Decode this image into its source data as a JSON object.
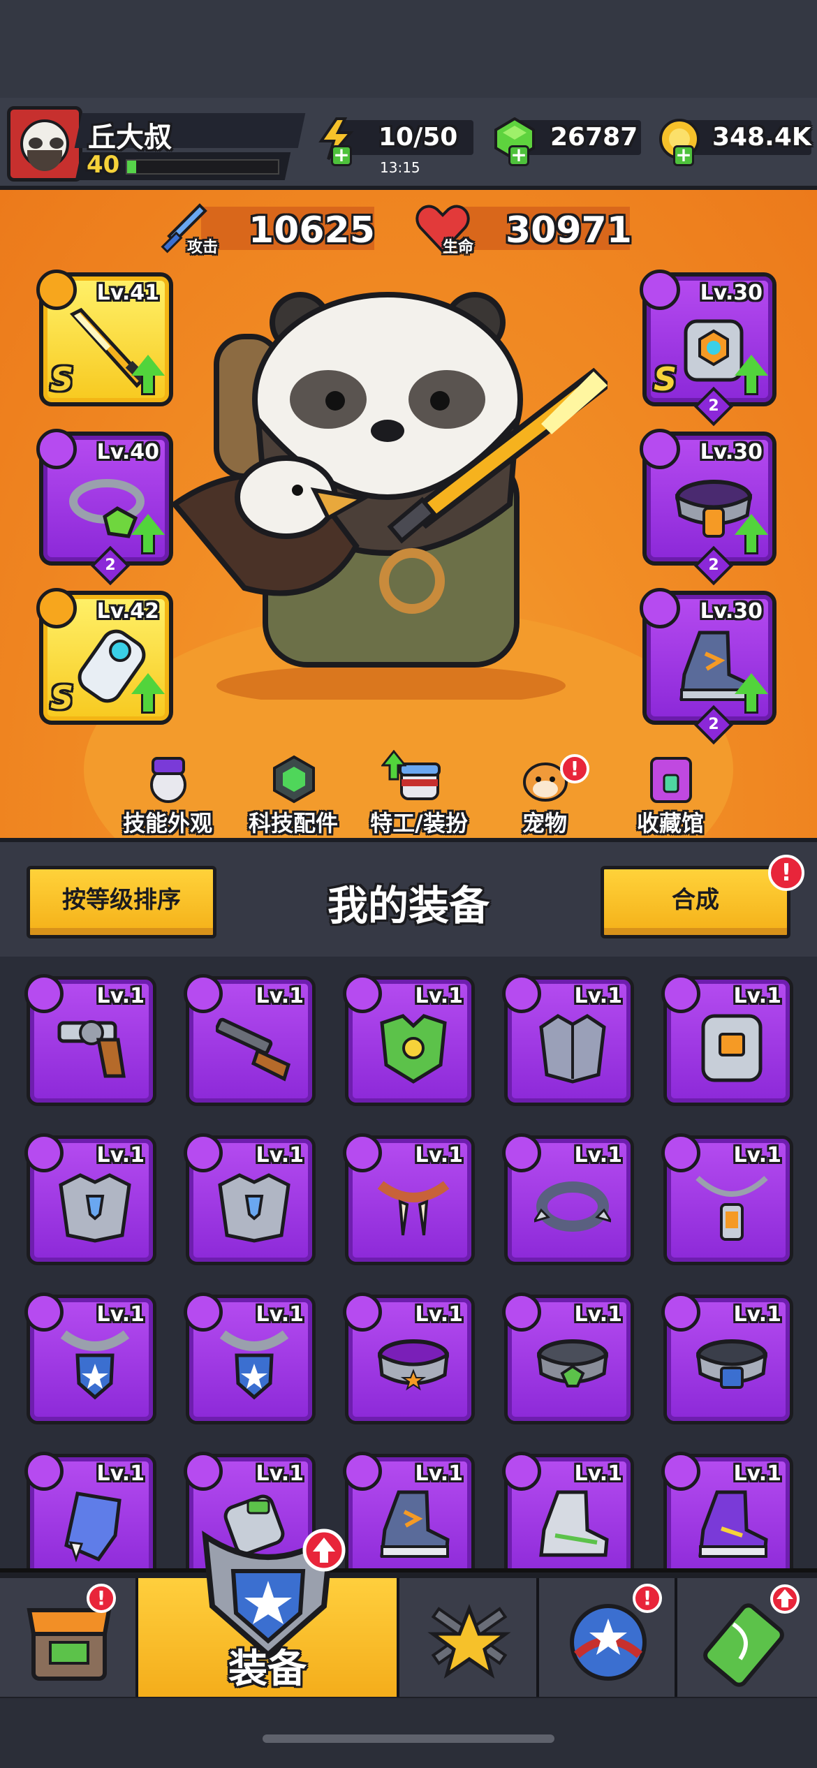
{
  "player": {
    "name": "丘大叔",
    "level": "40",
    "xp_fraction": 0.06
  },
  "resources": {
    "energy": {
      "value": "10/50",
      "timer": "13:15",
      "icon": "lightning-icon"
    },
    "gems": {
      "value": "26787",
      "icon": "gem-icon"
    },
    "coins": {
      "value": "348.4K",
      "icon": "coin-icon"
    }
  },
  "stats": {
    "attack": {
      "label": "攻击",
      "value": "10625",
      "icon": "sword-icon"
    },
    "health": {
      "label": "生命",
      "value": "30971",
      "icon": "heart-icon"
    }
  },
  "equipped": {
    "left": [
      {
        "level": "Lv.41",
        "grade": "S",
        "rarity": "gold",
        "kind": "weapon",
        "count": ""
      },
      {
        "level": "Lv.40",
        "grade": "",
        "rarity": "purple",
        "kind": "necklace",
        "count": "2"
      },
      {
        "level": "Lv.42",
        "grade": "S",
        "rarity": "gold",
        "kind": "glove",
        "count": ""
      }
    ],
    "right": [
      {
        "level": "Lv.30",
        "grade": "S",
        "rarity": "purple",
        "kind": "armor",
        "count": "2"
      },
      {
        "level": "Lv.30",
        "grade": "",
        "rarity": "purple",
        "kind": "belt",
        "count": "2"
      },
      {
        "level": "Lv.30",
        "grade": "",
        "rarity": "purple",
        "kind": "boots",
        "count": "2"
      }
    ]
  },
  "feature_tabs": [
    {
      "label": "技能外观",
      "icon": "skill-skin-icon",
      "alert": false
    },
    {
      "label": "科技配件",
      "icon": "tech-parts-icon",
      "alert": false
    },
    {
      "label": "特工/装扮",
      "icon": "agent-costume-icon",
      "alert": false,
      "upgrade": true
    },
    {
      "label": "宠物",
      "icon": "pet-icon",
      "alert": true
    },
    {
      "label": "收藏馆",
      "icon": "collection-icon",
      "alert": false
    }
  ],
  "inventory": {
    "title": "我的装备",
    "sort_label": "按等级排序",
    "merge_label": "合成",
    "merge_alert": "!",
    "rows": [
      [
        {
          "level": "Lv.1",
          "kind": "weapon",
          "art": "revolver-icon"
        },
        {
          "level": "Lv.1",
          "kind": "weapon",
          "art": "shotgun-icon"
        },
        {
          "level": "Lv.1",
          "kind": "armor",
          "art": "leaf-armor-icon"
        },
        {
          "level": "Lv.1",
          "kind": "armor",
          "art": "plate-armor-icon"
        },
        {
          "level": "Lv.1",
          "kind": "armor",
          "art": "vest-armor-icon"
        }
      ],
      [
        {
          "level": "Lv.1",
          "kind": "armor",
          "art": "chest-armor-icon"
        },
        {
          "level": "Lv.1",
          "kind": "armor",
          "art": "chest-armor-icon"
        },
        {
          "level": "Lv.1",
          "kind": "necklace",
          "art": "fang-necklace-icon"
        },
        {
          "level": "Lv.1",
          "kind": "necklace",
          "art": "spike-collar-icon"
        },
        {
          "level": "Lv.1",
          "kind": "necklace",
          "art": "lantern-necklace-icon"
        }
      ],
      [
        {
          "level": "Lv.1",
          "kind": "necklace",
          "art": "shield-necklace-icon"
        },
        {
          "level": "Lv.1",
          "kind": "necklace",
          "art": "shield-necklace-icon"
        },
        {
          "level": "Lv.1",
          "kind": "belt",
          "art": "star-belt-icon"
        },
        {
          "level": "Lv.1",
          "kind": "belt",
          "art": "gem-belt-icon"
        },
        {
          "level": "Lv.1",
          "kind": "belt",
          "art": "shield-belt-icon"
        }
      ],
      [
        {
          "level": "Lv.1",
          "kind": "glove",
          "art": "fur-glove-icon"
        },
        {
          "level": "Lv.1",
          "kind": "glove",
          "art": "mech-glove-icon"
        },
        {
          "level": "Lv.1",
          "kind": "boots",
          "art": "sneaker-icon"
        },
        {
          "level": "Lv.1",
          "kind": "boots",
          "art": "high-top-icon"
        },
        {
          "level": "Lv.1",
          "kind": "boots",
          "art": "purple-boot-icon"
        }
      ]
    ]
  },
  "bottom_nav": [
    {
      "label": "",
      "icon": "shop-icon",
      "alert": true
    },
    {
      "label": "装备",
      "icon": "equipment-icon",
      "active": true,
      "upgrade": true
    },
    {
      "label": "",
      "icon": "battle-icon",
      "alert": false
    },
    {
      "label": "",
      "icon": "talent-icon",
      "alert": true
    },
    {
      "label": "",
      "icon": "gene-icon",
      "upgrade": true
    }
  ],
  "colors": {
    "gold_slot": "#f7c91f",
    "purple_slot": "#8b28d8",
    "hero_bg": "#f28f26",
    "button_yellow": "#ffd23a",
    "alert_red": "#e8253a",
    "upgrade_green": "#52d43c"
  }
}
